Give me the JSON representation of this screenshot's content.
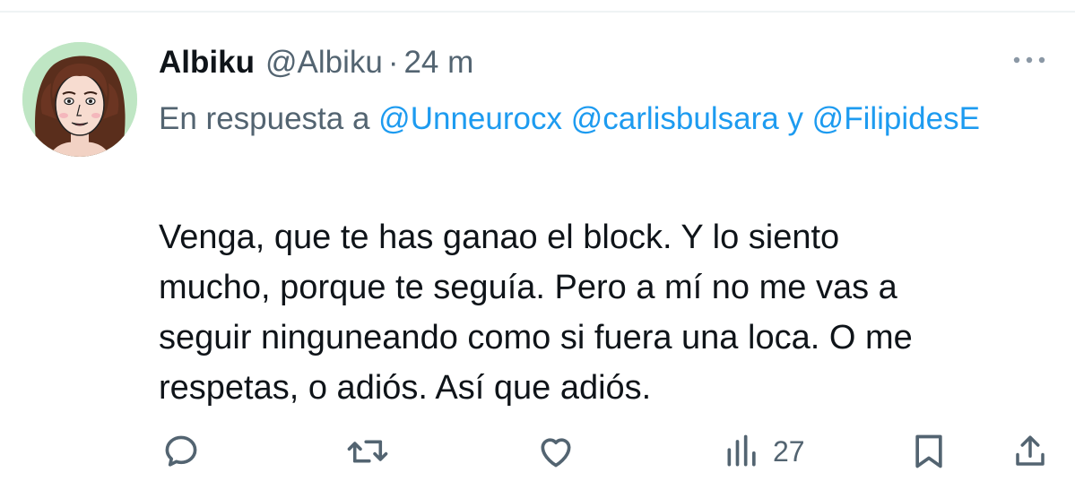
{
  "tweet": {
    "display_name": "Albiku",
    "handle": "@Albiku",
    "separator": "·",
    "timestamp": "24 m",
    "reply_context": {
      "prefix": "En respuesta a",
      "mention_1": "@Unneurocx",
      "mention_2": "@carlisbulsara",
      "conjunction": "y",
      "mention_3": "@FilipidesE"
    },
    "text": "Venga, que te has ganao el block. Y lo siento\nmucho, porque te seguía. Pero a mí no me vas a\nseguir ninguneando como si fuera una loca. O me\nrespetas, o adiós. Así que adiós.",
    "views_count": "27"
  },
  "colors": {
    "text_primary": "#0f1419",
    "text_secondary": "#536471",
    "accent": "#1d9bf0",
    "avatar_background": "#bfe6c4"
  },
  "icons": {
    "more": "more-horizontal-icon",
    "reply": "speech-bubble-icon",
    "retweet": "retweet-icon",
    "like": "heart-icon",
    "views": "bar-chart-icon",
    "bookmark": "bookmark-icon",
    "share": "share-upload-icon"
  }
}
